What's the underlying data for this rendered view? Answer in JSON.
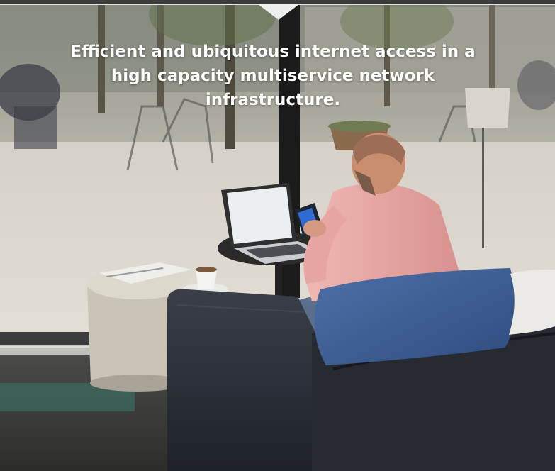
{
  "hero": {
    "headline": "Efficient and ubiquitous internet access in a high capacity multiservice network infrastructure.",
    "photo_subject": "Man in pink shirt using smartphone next to laptop on café table, seated on dark leather sofa by large window overlooking a courtyard",
    "colors": {
      "top_bar": "#3a3a3a",
      "notch": "#eeeeee",
      "headline_text": "#ffffff",
      "sofa": "#2c3038",
      "cushion": "#3e5f96",
      "shirt": "#e8a9a7"
    }
  }
}
